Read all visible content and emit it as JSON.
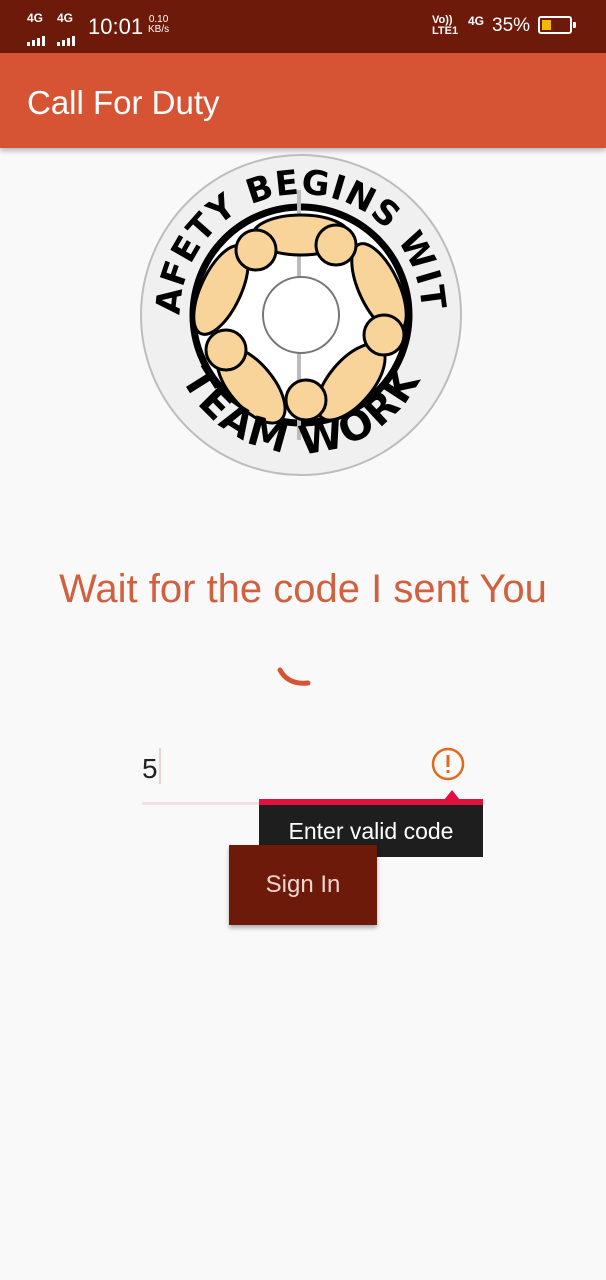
{
  "status_bar": {
    "network1": "4G",
    "network2": "4G",
    "time": "10:01",
    "speed_value": "0.10",
    "speed_unit": "KB/s",
    "volte_line1": "Vo))",
    "volte_line2": "LTE1",
    "network3": "4G",
    "battery_percent": "35%",
    "battery_level": 0.35,
    "icons": [
      "signal-icon",
      "signal-icon",
      "battery-icon"
    ]
  },
  "app_bar": {
    "title": "Call For Duty",
    "color": "#d65434"
  },
  "logo": {
    "top_text": "SAFETY BEGINS WITH",
    "bottom_text": "TEAM WORK"
  },
  "main": {
    "wait_message": "Wait for the code I sent You",
    "code_input": {
      "value": "5",
      "placeholder": ""
    },
    "error_tooltip": "Enter valid code",
    "sign_in_label": "Sign In"
  },
  "colors": {
    "status_bar": "#6d1a0a",
    "accent": "#d65434",
    "text_accent": "#d0603e",
    "error": "#e3103f",
    "button": "#6d1a0a"
  }
}
